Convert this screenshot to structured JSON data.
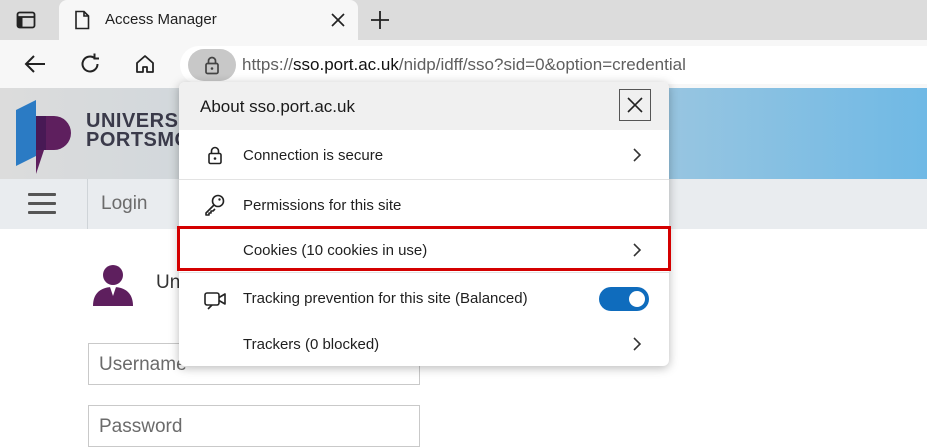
{
  "browser": {
    "tab": {
      "title": "Access Manager"
    },
    "address_bar": {
      "url_scheme": "https://",
      "url_host": "sso.port.ac.uk",
      "url_path": "/nidp/idff/sso?sid=0&option=credential"
    }
  },
  "site": {
    "logo_text_line1": "UNIVERS",
    "logo_text_line2": "PORTSMO",
    "menu": {
      "login_label": "Login"
    },
    "user_text": "Un",
    "username_placeholder": "Username",
    "password_placeholder": "Password"
  },
  "site_info_popup": {
    "title": "About sso.port.ac.uk",
    "items": [
      {
        "label": "Connection is secure",
        "icon": "lock-icon",
        "has_chevron": true
      },
      {
        "label": "Permissions for this site",
        "icon": "key-icon",
        "has_chevron": false
      },
      {
        "label": "Cookies (10 cookies in use)",
        "icon": "",
        "has_chevron": true,
        "highlighted": true
      },
      {
        "label": "Tracking prevention for this site (Balanced)",
        "icon": "tracking-camera-icon",
        "toggle_on": true
      },
      {
        "label": "Trackers (0 blocked)",
        "icon": "",
        "has_chevron": true
      }
    ]
  },
  "colors": {
    "toggle_on": "#0f6cbd",
    "highlight_border": "#d40000",
    "logo_purple": "#5e1f5e",
    "logo_blue": "#2b7bc4"
  }
}
